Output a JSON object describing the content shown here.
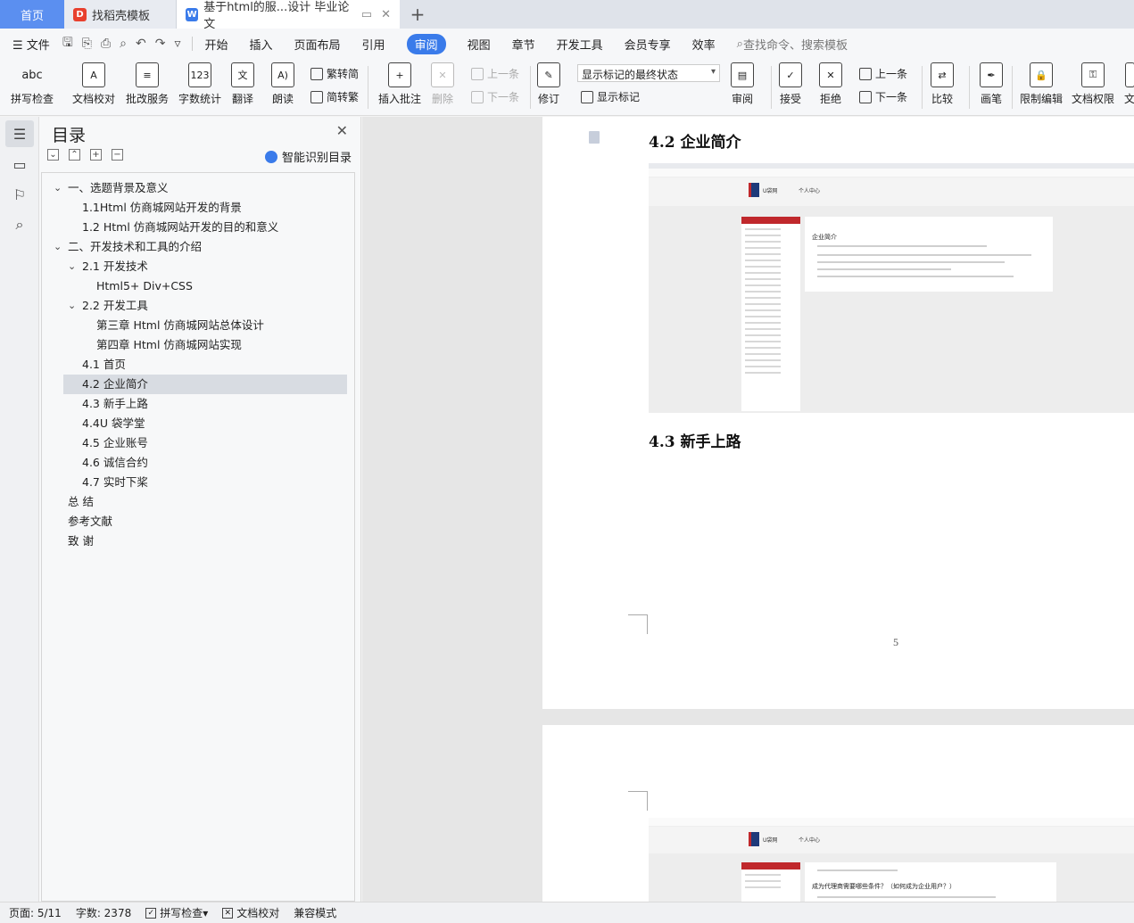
{
  "tabs": [
    {
      "label": "首页"
    },
    {
      "label": "找稻壳模板"
    },
    {
      "label": "基于html的服...设计  毕业论文"
    }
  ],
  "menu": {
    "file": "文件",
    "items": [
      "开始",
      "插入",
      "页面布局",
      "引用",
      "审阅",
      "视图",
      "章节",
      "开发工具",
      "会员专享",
      "效率"
    ],
    "active": "审阅",
    "search": "查找命令、搜索模板"
  },
  "ribbon": {
    "spell": "拼写检查",
    "doc_check": "文档校对",
    "review_service": "批改服务",
    "word_count": "字数统计",
    "translate": "翻译",
    "read_aloud": "朗读",
    "to_traditional": "繁转简",
    "to_simplified": "简转繁",
    "insert_comment": "插入批注",
    "delete": "删除",
    "prev": "上一条",
    "next": "下一条",
    "revise": "修订",
    "markup_state": "显示标记的最终状态",
    "show_markup": "显示标记",
    "review": "审阅",
    "accept": "接受",
    "reject": "拒绝",
    "prev2": "上一条",
    "next2": "下一条",
    "compare": "比较",
    "pen": "画笔",
    "restrict_edit": "限制编辑",
    "doc_permission": "文档权限",
    "cut_char": "文"
  },
  "toc": {
    "title": "目录",
    "smart": "智能识别目录",
    "items": [
      {
        "label": "一、选题背景及意义"
      },
      {
        "label": "1.1Html 仿商城网站开发的背景"
      },
      {
        "label": "1.2 Html 仿商城网站开发的目的和意义"
      },
      {
        "label": "二、开发技术和工具的介绍"
      },
      {
        "label": "2.1 开发技术"
      },
      {
        "label": "Html5+ Div+CSS"
      },
      {
        "label": "2.2 开发工具"
      },
      {
        "label": "第三章  Html 仿商城网站总体设计"
      },
      {
        "label": "第四章  Html 仿商城网站实现"
      },
      {
        "label": "4.1  首页"
      },
      {
        "label": "4.2 企业简介"
      },
      {
        "label": "4.3 新手上路"
      },
      {
        "label": "4.4U 袋学堂"
      },
      {
        "label": "4.5 企业账号"
      },
      {
        "label": "4.6 诚信合约"
      },
      {
        "label": "4.7 实时下桨"
      },
      {
        "label": "总   结"
      },
      {
        "label": "参考文献"
      },
      {
        "label": "致   谢"
      }
    ]
  },
  "doc": {
    "heading1": "4.2 企业简介",
    "heading2": "4.3 新手上路",
    "page_number": "5",
    "shot1": {
      "personal": "个人中心",
      "title": "企业简介"
    },
    "shot2": {
      "personal": "个人中心",
      "title": "成为代理商需要哪些条件？（如何成为企业用户？）"
    }
  },
  "status": {
    "page": "页面: 5/11",
    "words": "字数: 2378",
    "spell": "拼写检查",
    "doc_check": "文档校对",
    "compat": "兼容模式"
  }
}
